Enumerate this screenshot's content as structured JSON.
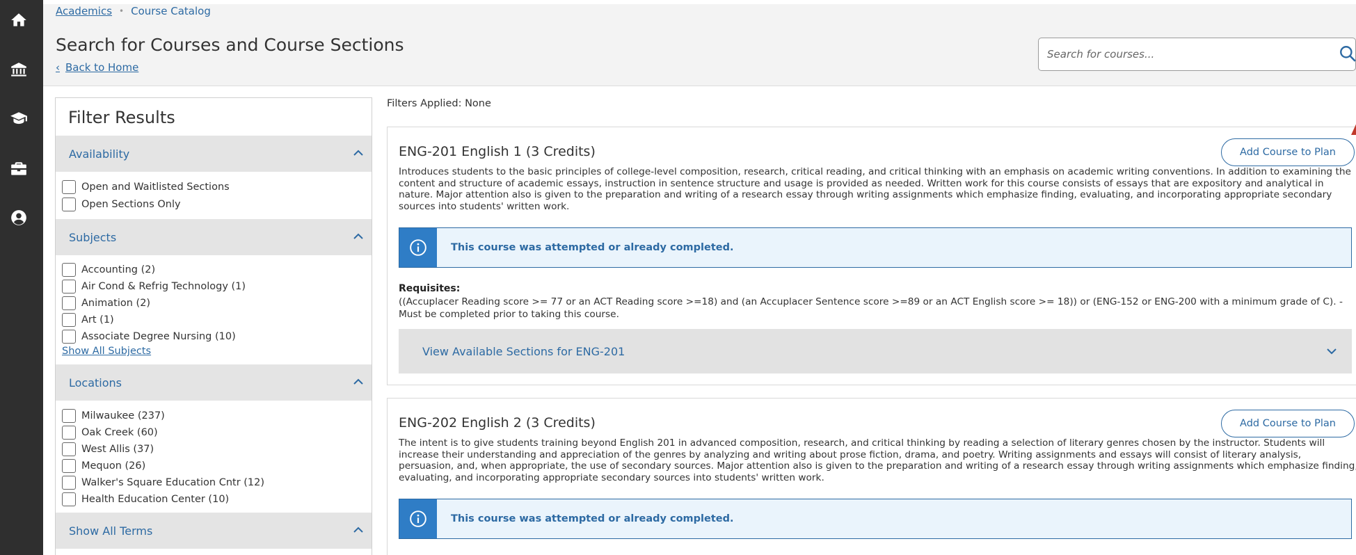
{
  "breadcrumb": {
    "academics": "Academics",
    "catalog": "Course Catalog"
  },
  "page": {
    "title": "Search for Courses and Course Sections",
    "back_link": "Back to Home"
  },
  "search": {
    "placeholder": "Search for courses..."
  },
  "sidebar": {
    "icons": [
      "home-icon",
      "institution-icon",
      "graduation-cap-icon",
      "briefcase-icon",
      "user-profile-icon"
    ]
  },
  "filters": {
    "title": "Filter Results",
    "applied": "Filters Applied: None",
    "availability": {
      "label": "Availability",
      "items": [
        "Open and Waitlisted Sections",
        "Open Sections Only"
      ]
    },
    "subjects": {
      "label": "Subjects",
      "items": [
        "Accounting (2)",
        "Air Cond & Refrig Technology (1)",
        "Animation (2)",
        "Art (1)",
        "Associate Degree Nursing (10)"
      ],
      "show_all": "Show All Subjects"
    },
    "locations": {
      "label": "Locations",
      "items": [
        "Milwaukee (237)",
        "Oak Creek (60)",
        "West Allis (37)",
        "Mequon (26)",
        "Walker's Square Education Cntr (12)",
        "Health Education Center (10)"
      ]
    },
    "terms": {
      "label": "Show All Terms"
    }
  },
  "courses": [
    {
      "title": "ENG-201 English 1 (3 Credits)",
      "add_label": "Add Course to Plan",
      "description": "Introduces students to the basic principles of college-level composition, research, critical reading, and critical thinking with an emphasis on academic writing conventions. In addition to examining the content and structure of academic essays, instruction in sentence structure and usage is provided as needed. Written work for this course consists of essays that are expository and analytical in nature. Major attention also is given to the preparation and writing of a research essay through writing assignments which emphasize finding, evaluating, and incorporating appropriate secondary sources into students' written work.",
      "notice": "This course was attempted or already completed.",
      "requisites_label": "Requisites:",
      "requisites": "((Accuplacer Reading score >= 77 or an ACT Reading score >=18) and (an Accuplacer Sentence score >=89 or an ACT English score >= 18)) or (ENG-152 or ENG-200 with a minimum grade of C). - Must be completed prior to taking this course.",
      "sections_label": "View Available Sections for ENG-201"
    },
    {
      "title": "ENG-202 English 2 (3 Credits)",
      "add_label": "Add Course to Plan",
      "description": "The intent is to give students training beyond English 201 in advanced composition, research, and critical thinking by reading a selection of literary genres chosen by the instructor. Students will increase their understanding and appreciation of the genres by analyzing and writing about prose fiction, drama, and poetry. Writing assignments and essays will consist of literary analysis, persuasion, and, when appropriate, the use of secondary sources. Major attention also is given to the preparation and writing of a research essay through writing assignments which emphasize finding, evaluating, and incorporating appropriate secondary sources into students' written work.",
      "notice": "This course was attempted or already completed."
    }
  ],
  "colors": {
    "accent": "#2d6aa3",
    "sidebar": "#2f2f2f",
    "info_icon_bg": "#2f7dc6",
    "banner_bg": "#eaf4fc"
  }
}
